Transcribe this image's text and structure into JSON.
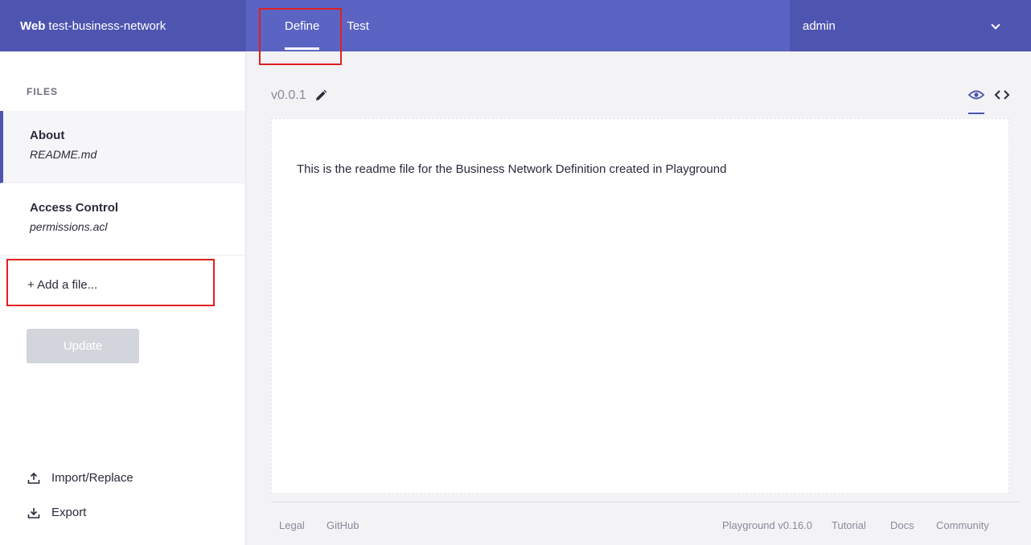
{
  "header": {
    "brand_bold": "Web",
    "brand_name": "test-business-network",
    "tabs": [
      {
        "label": "Define",
        "active": true
      },
      {
        "label": "Test",
        "active": false
      }
    ],
    "user": "admin",
    "user_icon": "chevron-down-icon"
  },
  "sidebar": {
    "section_label": "FILES",
    "files": [
      {
        "title": "About",
        "filename": "README.md",
        "active": true
      },
      {
        "title": "Access Control",
        "filename": "permissions.acl",
        "active": false
      }
    ],
    "add_file": "+ Add a file...",
    "update_button": "Update",
    "actions": [
      {
        "label": "Import/Replace",
        "icon": "upload-icon"
      },
      {
        "label": "Export",
        "icon": "download-icon"
      }
    ]
  },
  "main": {
    "version": "v0.0.1",
    "edit_icon": "pencil-icon",
    "view_modes": [
      "eye-icon",
      "code-icon"
    ],
    "readme_text": "This is the readme file for the Business Network Definition created in Playground"
  },
  "footer": {
    "links": [
      "Legal",
      "GitHub",
      "Playground v0.16.0",
      "Tutorial",
      "Docs",
      "Community"
    ]
  },
  "colors": {
    "header_bg": "#5b64c2",
    "header_dark": "#4e55b0",
    "highlight": "#e02020",
    "button_disabled": "#d3d5dc"
  }
}
